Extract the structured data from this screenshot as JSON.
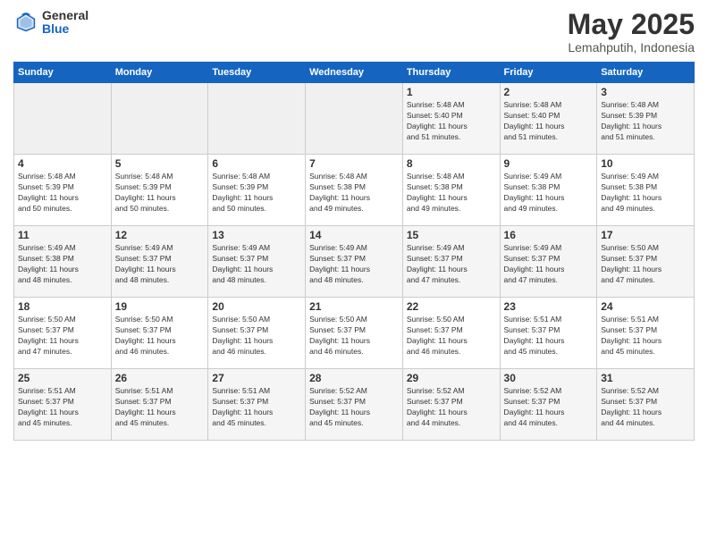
{
  "logo": {
    "general": "General",
    "blue": "Blue"
  },
  "title": "May 2025",
  "location": "Lemahputih, Indonesia",
  "days_of_week": [
    "Sunday",
    "Monday",
    "Tuesday",
    "Wednesday",
    "Thursday",
    "Friday",
    "Saturday"
  ],
  "weeks": [
    [
      {
        "day": "",
        "info": ""
      },
      {
        "day": "",
        "info": ""
      },
      {
        "day": "",
        "info": ""
      },
      {
        "day": "",
        "info": ""
      },
      {
        "day": "1",
        "info": "Sunrise: 5:48 AM\nSunset: 5:40 PM\nDaylight: 11 hours\nand 51 minutes."
      },
      {
        "day": "2",
        "info": "Sunrise: 5:48 AM\nSunset: 5:40 PM\nDaylight: 11 hours\nand 51 minutes."
      },
      {
        "day": "3",
        "info": "Sunrise: 5:48 AM\nSunset: 5:39 PM\nDaylight: 11 hours\nand 51 minutes."
      }
    ],
    [
      {
        "day": "4",
        "info": "Sunrise: 5:48 AM\nSunset: 5:39 PM\nDaylight: 11 hours\nand 50 minutes."
      },
      {
        "day": "5",
        "info": "Sunrise: 5:48 AM\nSunset: 5:39 PM\nDaylight: 11 hours\nand 50 minutes."
      },
      {
        "day": "6",
        "info": "Sunrise: 5:48 AM\nSunset: 5:39 PM\nDaylight: 11 hours\nand 50 minutes."
      },
      {
        "day": "7",
        "info": "Sunrise: 5:48 AM\nSunset: 5:38 PM\nDaylight: 11 hours\nand 49 minutes."
      },
      {
        "day": "8",
        "info": "Sunrise: 5:48 AM\nSunset: 5:38 PM\nDaylight: 11 hours\nand 49 minutes."
      },
      {
        "day": "9",
        "info": "Sunrise: 5:49 AM\nSunset: 5:38 PM\nDaylight: 11 hours\nand 49 minutes."
      },
      {
        "day": "10",
        "info": "Sunrise: 5:49 AM\nSunset: 5:38 PM\nDaylight: 11 hours\nand 49 minutes."
      }
    ],
    [
      {
        "day": "11",
        "info": "Sunrise: 5:49 AM\nSunset: 5:38 PM\nDaylight: 11 hours\nand 48 minutes."
      },
      {
        "day": "12",
        "info": "Sunrise: 5:49 AM\nSunset: 5:37 PM\nDaylight: 11 hours\nand 48 minutes."
      },
      {
        "day": "13",
        "info": "Sunrise: 5:49 AM\nSunset: 5:37 PM\nDaylight: 11 hours\nand 48 minutes."
      },
      {
        "day": "14",
        "info": "Sunrise: 5:49 AM\nSunset: 5:37 PM\nDaylight: 11 hours\nand 48 minutes."
      },
      {
        "day": "15",
        "info": "Sunrise: 5:49 AM\nSunset: 5:37 PM\nDaylight: 11 hours\nand 47 minutes."
      },
      {
        "day": "16",
        "info": "Sunrise: 5:49 AM\nSunset: 5:37 PM\nDaylight: 11 hours\nand 47 minutes."
      },
      {
        "day": "17",
        "info": "Sunrise: 5:50 AM\nSunset: 5:37 PM\nDaylight: 11 hours\nand 47 minutes."
      }
    ],
    [
      {
        "day": "18",
        "info": "Sunrise: 5:50 AM\nSunset: 5:37 PM\nDaylight: 11 hours\nand 47 minutes."
      },
      {
        "day": "19",
        "info": "Sunrise: 5:50 AM\nSunset: 5:37 PM\nDaylight: 11 hours\nand 46 minutes."
      },
      {
        "day": "20",
        "info": "Sunrise: 5:50 AM\nSunset: 5:37 PM\nDaylight: 11 hours\nand 46 minutes."
      },
      {
        "day": "21",
        "info": "Sunrise: 5:50 AM\nSunset: 5:37 PM\nDaylight: 11 hours\nand 46 minutes."
      },
      {
        "day": "22",
        "info": "Sunrise: 5:50 AM\nSunset: 5:37 PM\nDaylight: 11 hours\nand 46 minutes."
      },
      {
        "day": "23",
        "info": "Sunrise: 5:51 AM\nSunset: 5:37 PM\nDaylight: 11 hours\nand 45 minutes."
      },
      {
        "day": "24",
        "info": "Sunrise: 5:51 AM\nSunset: 5:37 PM\nDaylight: 11 hours\nand 45 minutes."
      }
    ],
    [
      {
        "day": "25",
        "info": "Sunrise: 5:51 AM\nSunset: 5:37 PM\nDaylight: 11 hours\nand 45 minutes."
      },
      {
        "day": "26",
        "info": "Sunrise: 5:51 AM\nSunset: 5:37 PM\nDaylight: 11 hours\nand 45 minutes."
      },
      {
        "day": "27",
        "info": "Sunrise: 5:51 AM\nSunset: 5:37 PM\nDaylight: 11 hours\nand 45 minutes."
      },
      {
        "day": "28",
        "info": "Sunrise: 5:52 AM\nSunset: 5:37 PM\nDaylight: 11 hours\nand 45 minutes."
      },
      {
        "day": "29",
        "info": "Sunrise: 5:52 AM\nSunset: 5:37 PM\nDaylight: 11 hours\nand 44 minutes."
      },
      {
        "day": "30",
        "info": "Sunrise: 5:52 AM\nSunset: 5:37 PM\nDaylight: 11 hours\nand 44 minutes."
      },
      {
        "day": "31",
        "info": "Sunrise: 5:52 AM\nSunset: 5:37 PM\nDaylight: 11 hours\nand 44 minutes."
      }
    ]
  ]
}
